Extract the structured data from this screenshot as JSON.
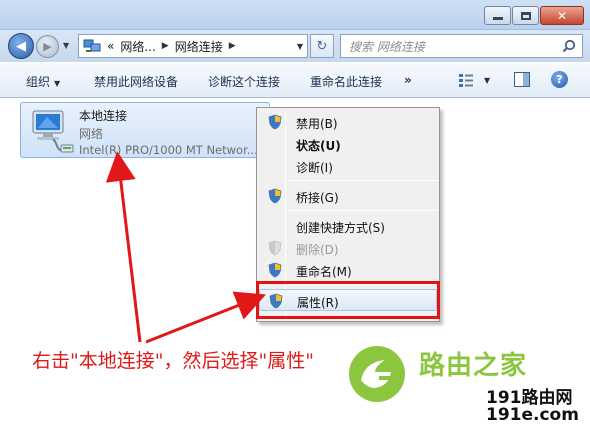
{
  "window": {
    "minimize_icon": "minimize-icon",
    "maximize_icon": "maximize-icon",
    "close_icon": "close-icon",
    "close_glyph": "✕"
  },
  "nav": {
    "back_glyph": "◀",
    "forward_glyph": "▶",
    "address": {
      "overflow": "«",
      "segment1": "网络...",
      "separator": "▶",
      "segment2": "网络连接",
      "separator2": "▶"
    },
    "refresh_glyph": "↻",
    "search_placeholder": "搜索 网络连接"
  },
  "toolbar": {
    "organize": "组织",
    "disable_device": "禁用此网络设备",
    "diagnose": "诊断这个连接",
    "rename": "重命名此连接",
    "more": "»",
    "help": "?"
  },
  "connection": {
    "name": "本地连接",
    "status": "网络",
    "device": "Intel(R) PRO/1000 MT Networ..."
  },
  "context_menu": {
    "items": [
      {
        "label": "禁用(B)",
        "icon": "shield-icon"
      },
      {
        "label": "状态(U)",
        "icon": "",
        "bold": true
      },
      {
        "label": "诊断(I)",
        "icon": ""
      },
      {
        "label": "桥接(G)",
        "icon": "shield-icon"
      },
      {
        "label": "创建快捷方式(S)",
        "icon": ""
      },
      {
        "label": "删除(D)",
        "icon": "shield-icon",
        "disabled": true
      },
      {
        "label": "重命名(M)",
        "icon": "shield-icon"
      },
      {
        "label": "属性(R)",
        "icon": "shield-icon",
        "highlighted": true
      }
    ]
  },
  "annotation": {
    "text": "右击\"本地连接\"，然后选择\"属性\"",
    "color": "#e01818"
  },
  "watermark": {
    "brand": "路由之家",
    "url1": "191路由网",
    "url2": "191e.com",
    "color": "#8cc63f"
  }
}
